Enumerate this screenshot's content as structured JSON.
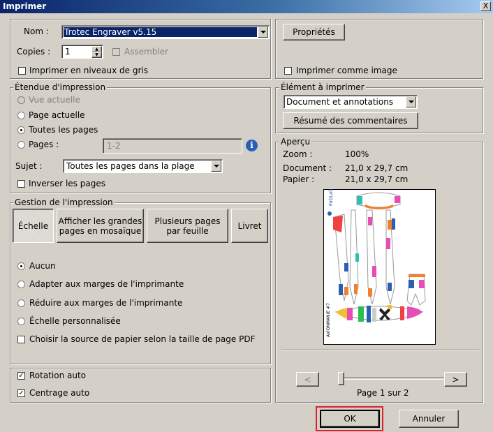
{
  "window": {
    "title": "Imprimer",
    "close": "X"
  },
  "printer": {
    "name_label": "Nom :",
    "name_value": "Trotec Engraver v5.15",
    "properties_button": "Propriétés",
    "copies_label": "Copies :",
    "copies_value": "1",
    "collate_label": "Assembler",
    "grayscale_label": "Imprimer en niveaux de gris",
    "as_image_label": "Imprimer comme image"
  },
  "range": {
    "legend": "Étendue d'impression",
    "current_view": "Vue actuelle",
    "current_page": "Page actuelle",
    "all_pages": "Toutes les pages",
    "pages_label": "Pages :",
    "pages_value": "1-2",
    "subject_label": "Sujet :",
    "subject_value": "Toutes les pages dans la plage",
    "reverse_label": "Inverser les pages",
    "info_icon_glyph": "i"
  },
  "element": {
    "legend": "Élément à imprimer",
    "value": "Document et annotations",
    "summary_button": "Résumé des commentaires"
  },
  "management": {
    "legend": "Gestion de l'impression",
    "tab_scale": "Échelle",
    "tab_tile_line1": "Afficher les grandes",
    "tab_tile_line2": "pages en mosaïque",
    "tab_multi_line1": "Plusieurs pages",
    "tab_multi_line2": "par feuille",
    "tab_booklet": "Livret",
    "opt_none": "Aucun",
    "opt_fit": "Adapter aux marges de l'imprimante",
    "opt_shrink": "Réduire aux marges de l'imprimante",
    "opt_custom": "Échelle personnalisée",
    "opt_paper_source": "Choisir la source de papier selon la taille de page PDF"
  },
  "auto": {
    "rotate": "Rotation auto",
    "center": "Centrage auto"
  },
  "preview": {
    "legend": "Aperçu",
    "zoom_label": "Zoom :",
    "zoom_value": "100%",
    "document_label": "Document :",
    "document_value": "21,0 x 29,7 cm",
    "paper_label": "Papier :",
    "paper_value": "21,0 x 29,7 cm",
    "prev": "<",
    "next": ">",
    "page_status": "Page 1 sur 2",
    "slider_fraction": 0,
    "page_text_logo": "FabLab",
    "page_text_side": "AVIONMANIE #7"
  },
  "actions": {
    "ok": "OK",
    "cancel": "Annuler"
  },
  "colors": {
    "accent_highlight": "#e0202a",
    "title_bar": "#0a246a"
  }
}
